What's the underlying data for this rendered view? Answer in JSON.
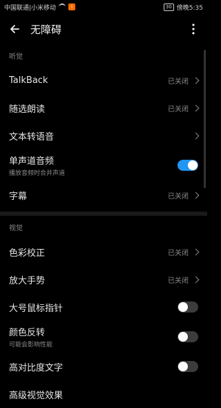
{
  "status": {
    "carrier": "中国联通|小米移动",
    "battery": "30",
    "time": "傍晚5:35"
  },
  "appbar": {
    "title": "无障碍"
  },
  "sections": {
    "hearing": "听觉",
    "vision": "视觉"
  },
  "items": {
    "talkback": {
      "label": "TalkBack",
      "value": "已关闭"
    },
    "select_to_speak": {
      "label": "随选朗读",
      "value": "已关闭"
    },
    "tts": {
      "label": "文本转语音"
    },
    "mono_audio": {
      "label": "单声道音频",
      "sub": "播放音频时合并声道",
      "toggle": "on"
    },
    "captions": {
      "label": "字幕",
      "value": "已关闭"
    },
    "color_correction": {
      "label": "色彩校正",
      "value": "已关闭"
    },
    "magnification": {
      "label": "放大手势",
      "value": "已关闭"
    },
    "large_pointer": {
      "label": "大号鼠标指针",
      "toggle": "off"
    },
    "color_inversion": {
      "label": "颜色反转",
      "sub": "可能会影响性能",
      "toggle": "off"
    },
    "high_contrast": {
      "label": "高对比度文字",
      "toggle": "off"
    },
    "partial": {
      "label": "高级视觉效果"
    }
  }
}
